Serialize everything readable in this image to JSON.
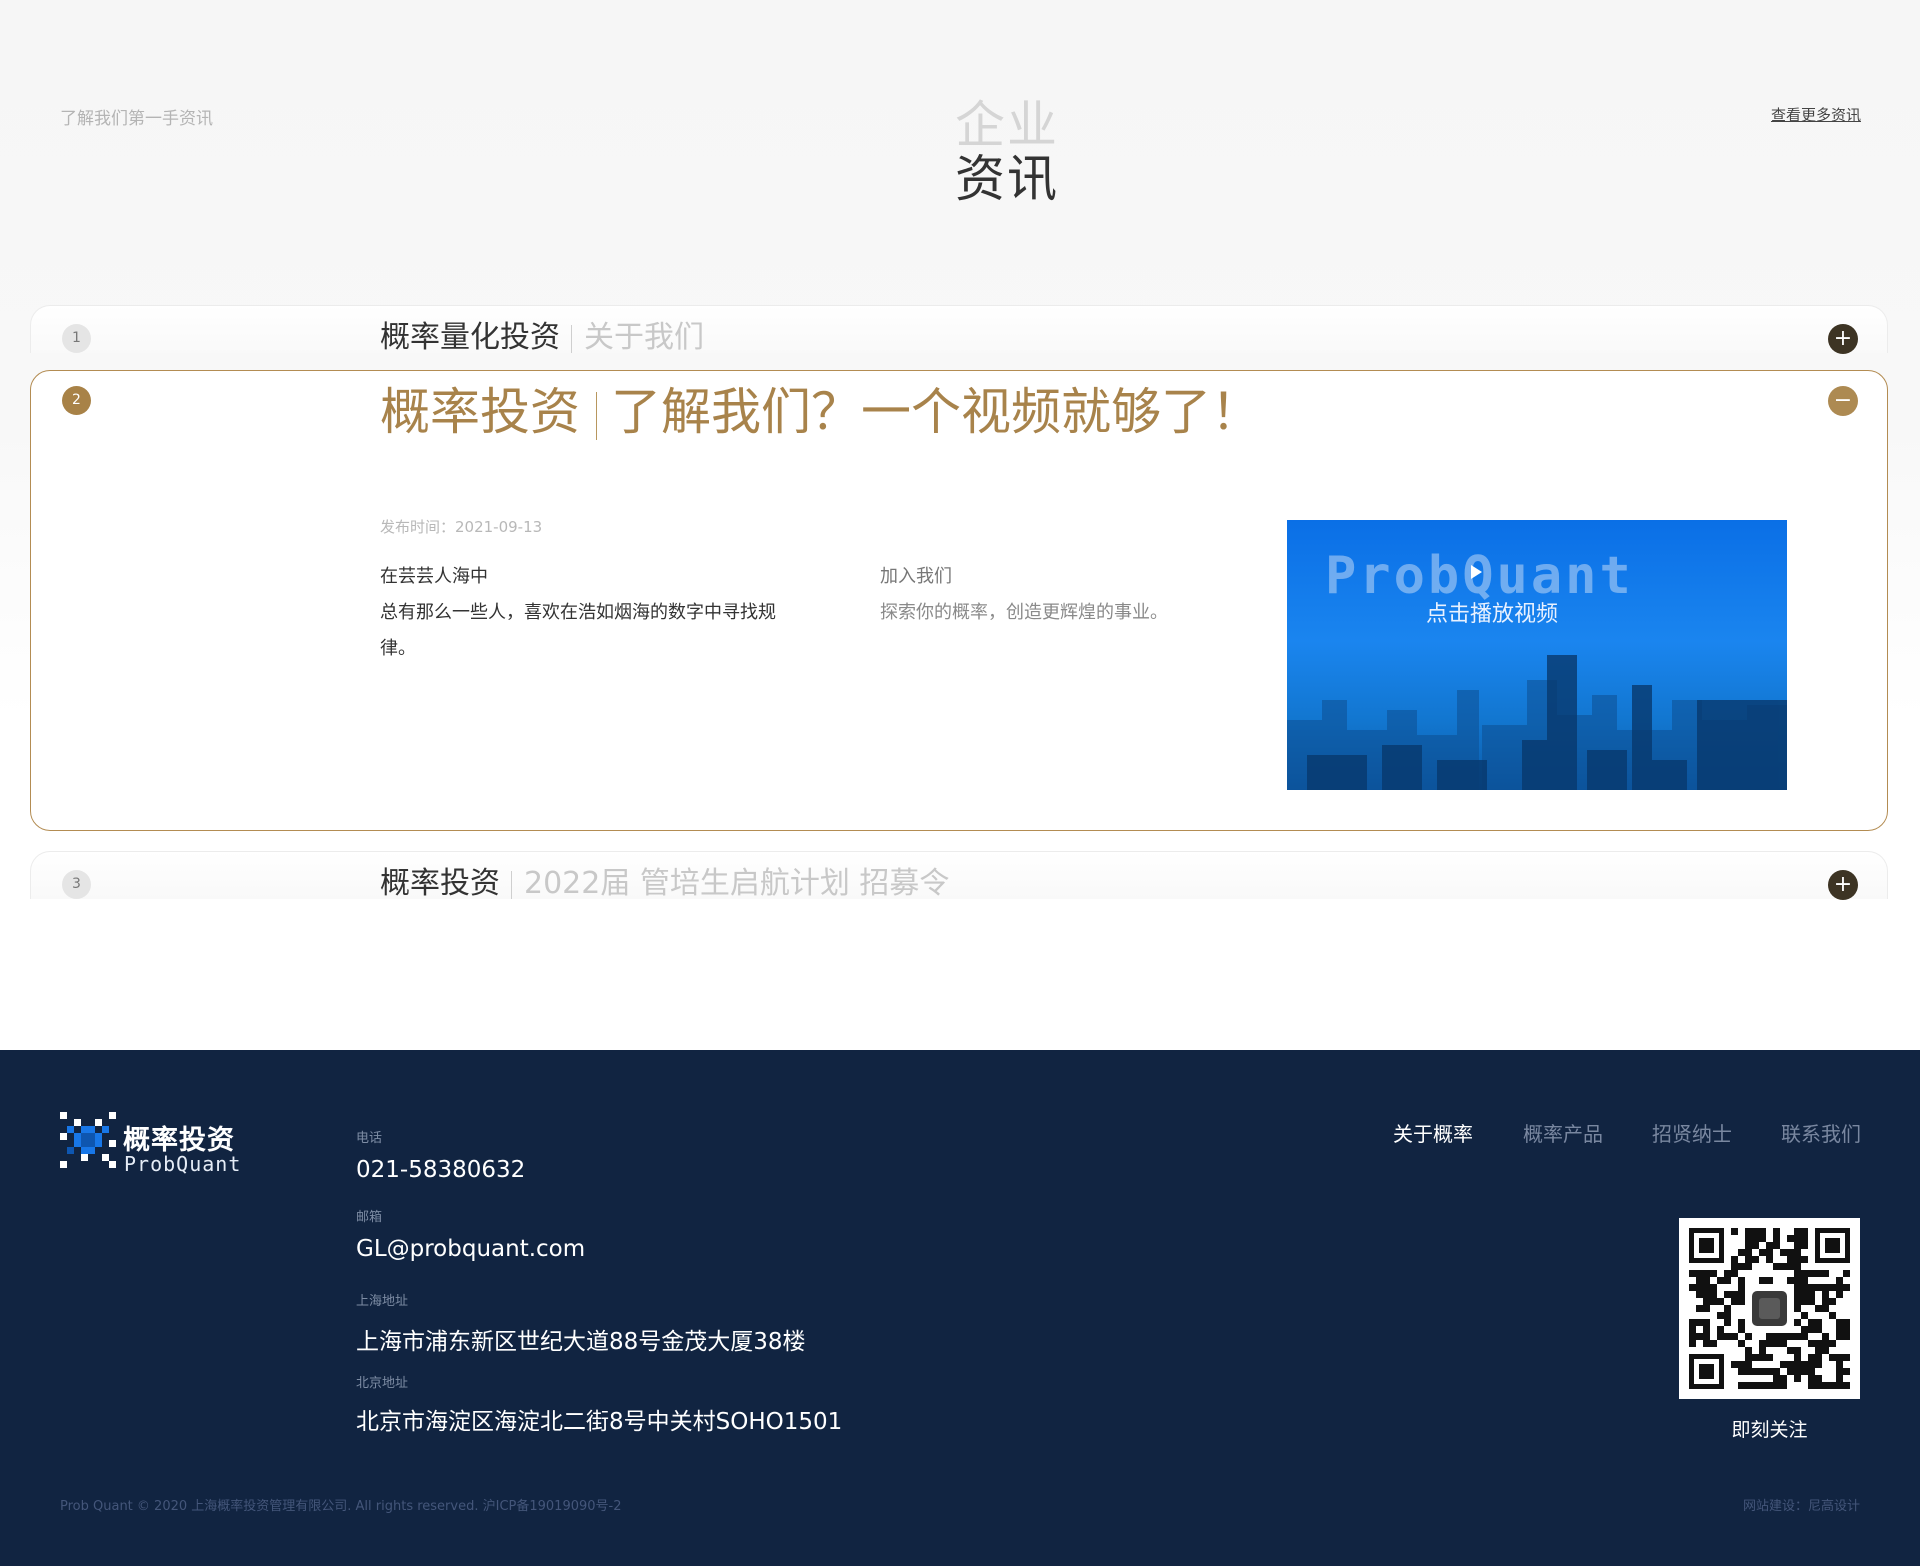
{
  "news": {
    "intro": "了解我们第一手资讯",
    "title_top": "企业",
    "title_bottom": "资讯",
    "more_link": "查看更多资讯",
    "items": [
      {
        "num": "1",
        "main": "概率量化投资",
        "sub": "关于我们"
      },
      {
        "num": "2",
        "main": "概率投资",
        "sub": "了解我们？一个视频就够了！",
        "date": "发布时间：2021-09-13",
        "col1": [
          "在芸芸人海中",
          "总有那么一些人，喜欢在浩如烟海的数字中寻找规律。"
        ],
        "col2_heading": "加入我们",
        "col2_text": "探索你的概率，创造更辉煌的事业。",
        "video_brand": "ProbQuant",
        "video_label": "点击播放视频"
      },
      {
        "num": "3",
        "main": "概率投资",
        "sub": "2022届 管培生启航计划 招募令"
      }
    ],
    "toggle_closed": "+",
    "toggle_open": "−",
    "accent": "#a8834b"
  },
  "footer": {
    "logo_cn": "概率投资",
    "logo_en": "ProbQuant",
    "phone_label": "电话",
    "phone": "021-58380632",
    "email_label": "邮箱",
    "email": "GL@probquant.com",
    "sh_label": "上海地址",
    "sh_addr": "上海市浦东新区世纪大道88号金茂大厦38楼",
    "bj_label": "北京地址",
    "bj_addr": "北京市海淀区海淀北二街8号中关村SOHO1501",
    "nav": [
      "关于概率",
      "概率产品",
      "招贤纳士",
      "联系我们"
    ],
    "qr_label": "即刻关注",
    "copyright": "Prob Quant © 2020 上海概率投资管理有限公司. All rights reserved.    沪ICP备19019090号-2",
    "credit": "网站建设：尼高设计",
    "bg": "#112441"
  }
}
